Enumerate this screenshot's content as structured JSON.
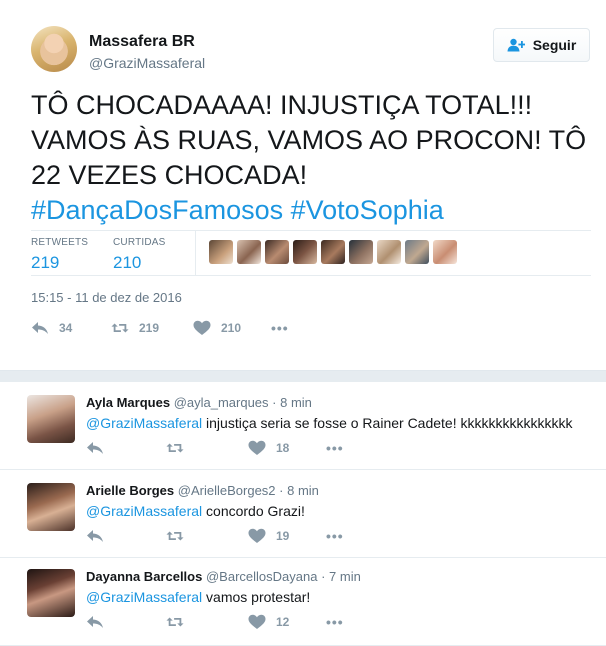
{
  "tweet": {
    "display_name": "Massafera BR",
    "handle": "@GraziMassaferal",
    "follow_label": "Seguir",
    "text_lines": [
      "TÔ CHOCADAAAA! INJUSTIÇA TOTAL!!!",
      "VAMOS ÀS RUAS, VAMOS AO PROCON! TÔ",
      "22 VEZES CHOCADA!"
    ],
    "hashtags": "#DançaDosFamosos #VotoSophia",
    "stats": {
      "retweets_label": "RETWEETS",
      "retweets": "219",
      "likes_label": "CURTIDAS",
      "likes": "210"
    },
    "timestamp": "15:15 - 11 de dez de 2016",
    "actions": {
      "replies": "34",
      "retweets": "219",
      "likes": "210",
      "more": "•••"
    },
    "colors": {
      "accent": "#1b95e0",
      "muted": "#8899a6",
      "text": "#14171a"
    }
  },
  "replies": [
    {
      "name": "Ayla Marques",
      "handle": "@ayla_marques",
      "time": "· 8 min",
      "mention": "@GraziMassaferal",
      "text": " injustiça seria se fosse o Rainer Cadete! kkkkkkkkkkkkkkkk",
      "likes": "18"
    },
    {
      "name": "Arielle Borges",
      "handle": "@ArielleBorges2",
      "time": "· 8 min",
      "mention": "@GraziMassaferal",
      "text": " concordo Grazi!",
      "likes": "19"
    },
    {
      "name": "Dayanna Barcellos",
      "handle": "@BarcellosDayana",
      "time": "· 7 min",
      "mention": "@GraziMassaferal",
      "text": " vamos protestar!",
      "likes": "12"
    }
  ]
}
